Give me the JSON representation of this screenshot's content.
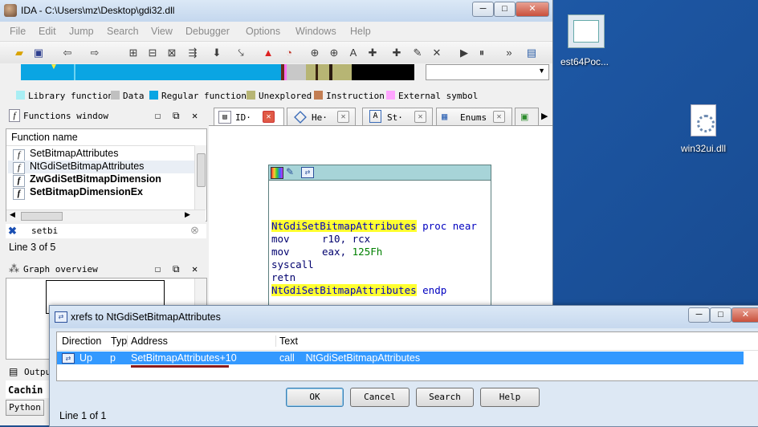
{
  "window": {
    "title": "IDA - C:\\Users\\mz\\Desktop\\gdi32.dll",
    "min": "─",
    "max": "□",
    "close": "✕"
  },
  "menu": [
    "File",
    "Edit",
    "Jump",
    "Search",
    "View",
    "Debugger",
    "Options",
    "Windows",
    "Help"
  ],
  "legend": [
    "Library function",
    "Data",
    "Regular function",
    "Unexplored",
    "Instruction",
    "External symbol"
  ],
  "colors": {
    "library": "#a9eef4",
    "data": "#c0c0c0",
    "regular": "#0aa5e3",
    "unexplored": "#b7b574",
    "instruction": "#c37e53",
    "external": "#ffa4ff"
  },
  "functions_window": {
    "title": "Functions window",
    "column": "Function name",
    "items": [
      {
        "name": "SetBitmapAttributes",
        "bold": false
      },
      {
        "name": "NtGdiSetBitmapAttributes",
        "bold": false
      },
      {
        "name": "ZwGdiSetBitmapDimension",
        "bold": true
      },
      {
        "name": "SetBitmapDimensionEx",
        "bold": true
      }
    ],
    "filter": "setbi",
    "status": "Line 3 of 5"
  },
  "graph_overview": {
    "title": "Graph overview"
  },
  "output": {
    "title": "Outpu",
    "text": "Cachin",
    "python_label": "Python"
  },
  "tabs": [
    "ID·",
    "He·",
    "St·",
    "Enums"
  ],
  "code": [
    {
      "label": "NtGdiSetBitmapAttributes",
      "rest": " proc near"
    },
    {
      "mnemonic": "mov",
      "operands": "r10, rcx"
    },
    {
      "mnemonic": "mov",
      "operands": "eax, ",
      "num": "125Fh"
    },
    {
      "mnemonic": "syscall",
      "operands": ""
    },
    {
      "mnemonic": "retn",
      "operands": ""
    },
    {
      "label": "NtGdiSetBitmapAttributes",
      "rest": " endp"
    }
  ],
  "xrefs": {
    "title": "xrefs to NtGdiSetBitmapAttributes",
    "columns": [
      "Direction",
      "Typ",
      "Address",
      "Text"
    ],
    "row": {
      "direction": "Up",
      "type": "p",
      "address": "SetBitmapAttributes+10",
      "text": "call    NtGdiSetBitmapAttributes"
    },
    "buttons": [
      "OK",
      "Cancel",
      "Search",
      "Help"
    ],
    "status": "Line 1 of 1"
  },
  "desktop": {
    "icon1": "est64Poc...",
    "icon2": "win32ui.dll"
  }
}
